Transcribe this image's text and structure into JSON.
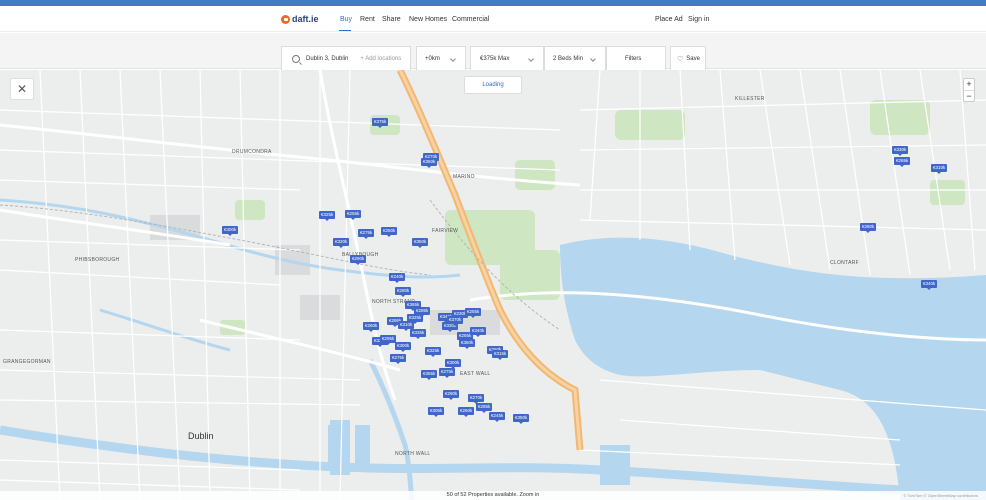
{
  "header": {
    "logo_text": "daft.ie",
    "nav": [
      "Buy",
      "Rent",
      "Share",
      "New Homes",
      "Commercial"
    ],
    "active_tab": "Buy",
    "place_ad": "Place Ad",
    "sign_in": "Sign in"
  },
  "filters": {
    "location": "Dublin 3, Dublin",
    "add_locations": "+ Add locations",
    "radius": "+0km",
    "price_max": "€375k Max",
    "beds_min": "2 Beds Min",
    "filters_label": "Filters",
    "save_label": "Save"
  },
  "map": {
    "loading_text": "Loading",
    "zoom_in": "+",
    "zoom_out": "−",
    "close_symbol": "✕",
    "status_text": "50 of 52 Properties available. Zoom in",
    "attribution": "© TomTom © OpenStreetMap contributors",
    "labels": [
      "DRUMCONDRA",
      "PHIBSBOROUGH",
      "BALLYBOUGH",
      "NORTH STRAND",
      "EAST WALL",
      "NORTH WALL",
      "CLONTARF",
      "MARINO",
      "FAIRVIEW",
      "KILLESTER",
      "GRANGEGORMAN",
      "Dublin"
    ],
    "pins": [
      "€375k",
      "€270k",
      "€300k",
      "€325k",
      "€255k",
      "€275k",
      "€250k",
      "€290k",
      "€320k",
      "€350k",
      "€240k",
      "€280k",
      "€365k",
      "€295k",
      "€260k",
      "€310k",
      "€285k",
      "€335k",
      "€345k",
      "€230k",
      "€330k",
      "€265k",
      "€340k",
      "€360k",
      "€325k",
      "€300k",
      "€275k",
      "€355k",
      "€250k",
      "€315k",
      "€290k",
      "€270k",
      "€285k",
      "€260k",
      "€305k",
      "€350k",
      "€245k",
      "€275k",
      "€320k",
      "€295k",
      "€330k",
      "€265k",
      "€310k",
      "€280k",
      "€340k",
      "€360k",
      "€255k",
      "€300k",
      "€325k",
      "€370k"
    ]
  }
}
